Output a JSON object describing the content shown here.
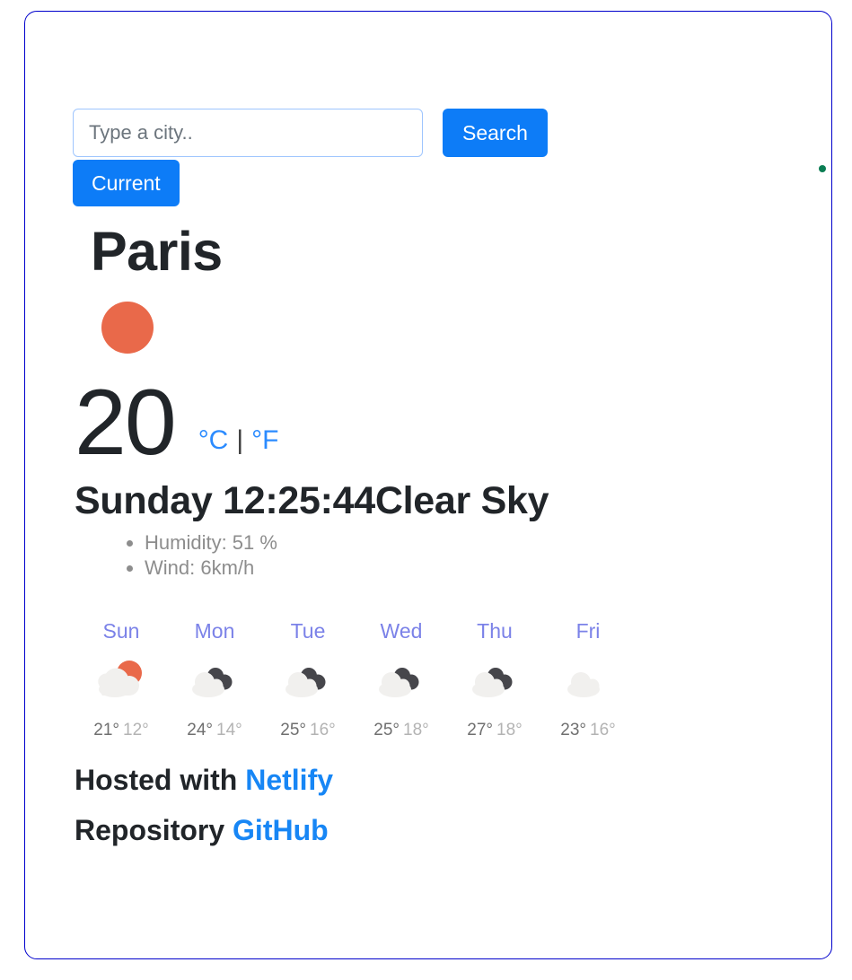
{
  "search": {
    "placeholder": "Type a city..",
    "value": "",
    "search_label": "Search",
    "current_label": "Current"
  },
  "status": {
    "dot_color": "#0a7d53"
  },
  "current": {
    "city": "Paris",
    "icon": "sun-icon",
    "icon_color": "#e9694a",
    "temperature": "20",
    "unit_celsius": "°C",
    "unit_separator": "|",
    "unit_fahrenheit": "°F",
    "date_time": "Sunday 12:25:44",
    "description": "Clear Sky",
    "details": [
      "Humidity: 51 %",
      "Wind: 6km/h"
    ]
  },
  "forecast": [
    {
      "day": "Sun",
      "icon": "sun-behind-cloud-icon",
      "max": "21°",
      "min": "12°"
    },
    {
      "day": "Mon",
      "icon": "cloud-behind-cloud-icon",
      "max": "24°",
      "min": "14°"
    },
    {
      "day": "Tue",
      "icon": "cloud-behind-cloud-icon",
      "max": "25°",
      "min": "16°"
    },
    {
      "day": "Wed",
      "icon": "cloud-behind-cloud-icon",
      "max": "25°",
      "min": "18°"
    },
    {
      "day": "Thu",
      "icon": "cloud-behind-cloud-icon",
      "max": "27°",
      "min": "18°"
    },
    {
      "day": "Fri",
      "icon": "cloud-icon",
      "max": "23°",
      "min": "16°"
    }
  ],
  "footer": {
    "hosted_prefix": "Hosted with",
    "hosted_link": "Netlify",
    "repo_prefix": "Repository",
    "repo_link": "GitHub"
  },
  "colors": {
    "accent_blue": "#0d7cf7",
    "link_blue": "#1786f5",
    "day_label": "#7b82e8",
    "sun_orange": "#e9694a",
    "frame_border": "#0000cc"
  }
}
